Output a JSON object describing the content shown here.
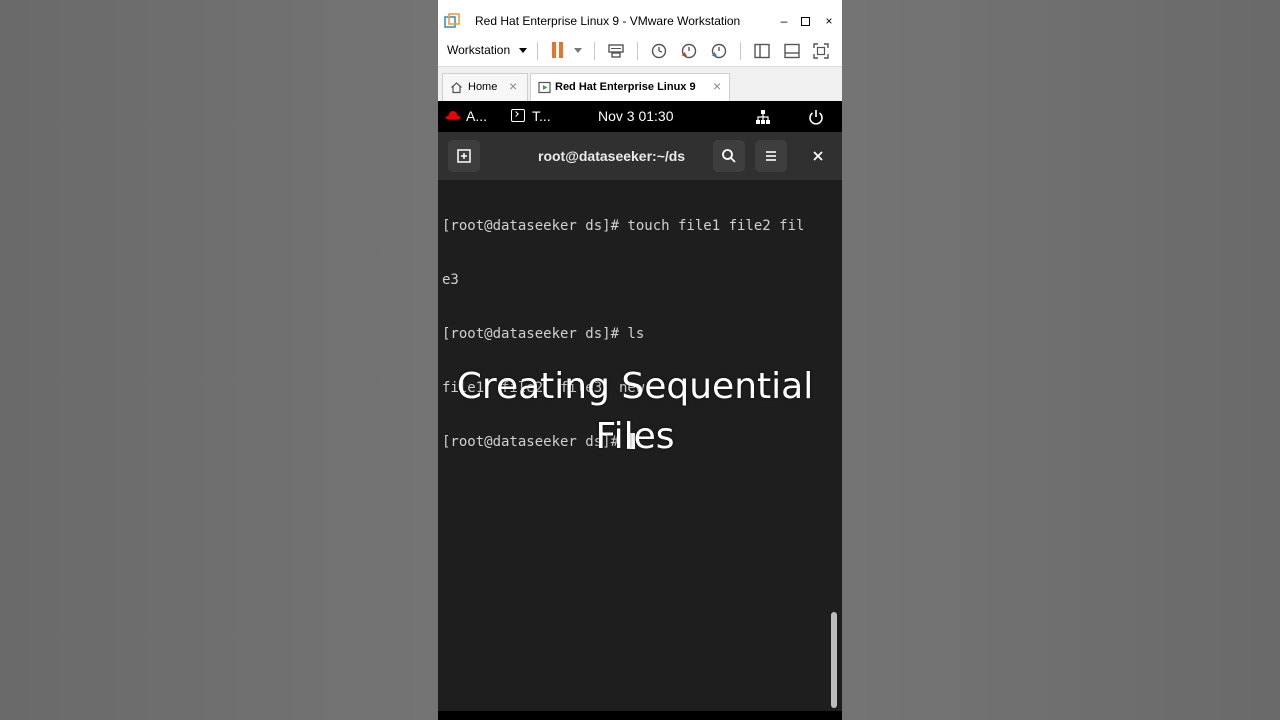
{
  "window": {
    "title": "Red Hat Enterprise Linux 9 - VMware Workstation",
    "minimize": "–",
    "close": "×"
  },
  "toolbar": {
    "menu_label": "Workstation"
  },
  "tabs": [
    {
      "label": "Home",
      "close": "×"
    },
    {
      "label": "Red Hat Enterprise Linux 9",
      "close": "×"
    }
  ],
  "gnome": {
    "activities": "A...",
    "terminal_app": "T...",
    "clock": "Nov 3  01:30"
  },
  "terminal": {
    "title": "root@dataseeker:~/ds",
    "lines": [
      "[root@dataseeker ds]# touch file1 file2 fil",
      "e3",
      "[root@dataseeker ds]# ls",
      "file1  file2  file3  new"
    ],
    "prompt": "[root@dataseeker ds]# "
  },
  "caption": {
    "line1": "Creating Sequential",
    "line2": "Files"
  },
  "colors": {
    "pause_accent": "#e8742b",
    "redhat": "#ee0000",
    "terminal_bg": "#1e1e1e"
  }
}
